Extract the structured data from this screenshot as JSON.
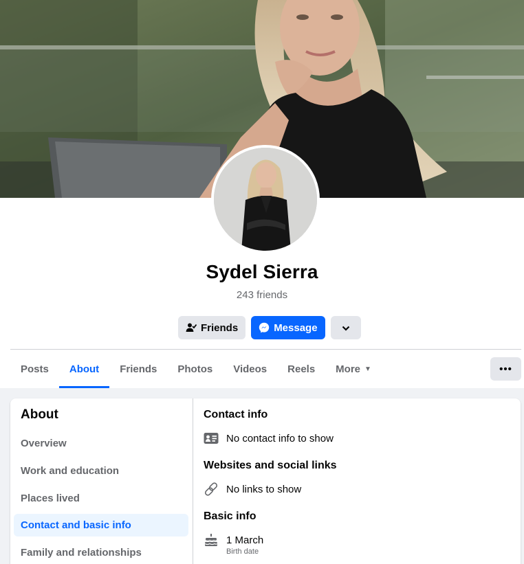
{
  "profile": {
    "name": "Sydel Sierra",
    "friends_count": "243 friends"
  },
  "actions": {
    "friends_label": "Friends",
    "message_label": "Message"
  },
  "tabs": [
    {
      "label": "Posts"
    },
    {
      "label": "About"
    },
    {
      "label": "Friends"
    },
    {
      "label": "Photos"
    },
    {
      "label": "Videos"
    },
    {
      "label": "Reels"
    },
    {
      "label": "More"
    }
  ],
  "more_menu_label": "•••",
  "about": {
    "title": "About",
    "nav": [
      {
        "label": "Overview"
      },
      {
        "label": "Work and education"
      },
      {
        "label": "Places lived"
      },
      {
        "label": "Contact and basic info"
      },
      {
        "label": "Family and relationships"
      }
    ],
    "active_nav": "Contact and basic info"
  },
  "contact": {
    "contact_title": "Contact info",
    "contact_empty": "No contact info to show",
    "links_title": "Websites and social links",
    "links_empty": "No links to show",
    "basic_title": "Basic info",
    "birth_value": "1 March",
    "birth_label": "Birth date"
  },
  "colors": {
    "accent": "#0866ff",
    "secondary_text": "#65676b",
    "button_gray": "#e4e6eb",
    "page_bg": "#f0f2f5"
  },
  "icons": [
    "person-check-icon",
    "messenger-icon",
    "chevron-down-icon",
    "contact-card-icon",
    "link-icon",
    "birthday-cake-icon"
  ]
}
